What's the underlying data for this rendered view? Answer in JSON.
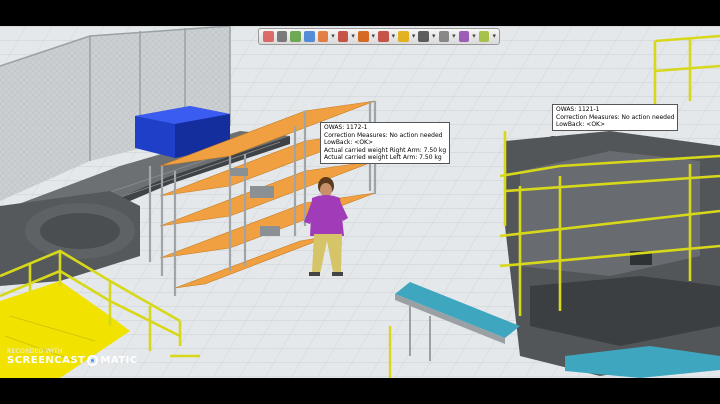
{
  "toolbar": {
    "buttons": [
      {
        "icon": "zoom-fit-icon",
        "color": "#d9534f"
      },
      {
        "icon": "zoom-icon",
        "color": "#666666"
      },
      {
        "icon": "pan-icon",
        "color": "#5a9e3a"
      },
      {
        "icon": "cube-view-icon",
        "color": "#3a7bd5"
      },
      {
        "icon": "object-icon",
        "color": "#e26b2a"
      },
      {
        "icon": "pin-icon",
        "color": "#c0392b"
      },
      {
        "icon": "measure-icon",
        "color": "#d35400"
      },
      {
        "icon": "box-icon",
        "color": "#c0392b"
      },
      {
        "icon": "paint-icon",
        "color": "#e0a800"
      },
      {
        "icon": "select-icon",
        "color": "#444444"
      },
      {
        "icon": "tag-icon",
        "color": "#777777"
      },
      {
        "icon": "snap-icon",
        "color": "#8e44ad"
      },
      {
        "icon": "ruler-icon",
        "color": "#9bbb2e"
      }
    ]
  },
  "tooltips": {
    "left": {
      "lines": [
        "OWAS:  1172-1",
        "Correction Measures: No action needed",
        "LowBack:  <OK>",
        "Actual carried weight Right Arm: 7.50 kg",
        "Actual carried weight Left Arm: 7.50 kg"
      ]
    },
    "right": {
      "lines": [
        "OWAS:   1121-1",
        "Correction Measures: No action needed",
        "LowBack:  <OK>"
      ]
    }
  },
  "watermark": {
    "top": "RECORDED WITH",
    "brand_left": "SCREENCAST",
    "brand_right": "MATIC"
  },
  "colors": {
    "floor": "#e4e8ea",
    "shelf": "#f0a040",
    "conveyor_belt": "#3fa6c0",
    "railing": "#d8d81a",
    "platform": "#f2e200",
    "blue_box": "#1f3fc8",
    "machine": "#525659",
    "worker_shirt": "#a13cb8"
  }
}
